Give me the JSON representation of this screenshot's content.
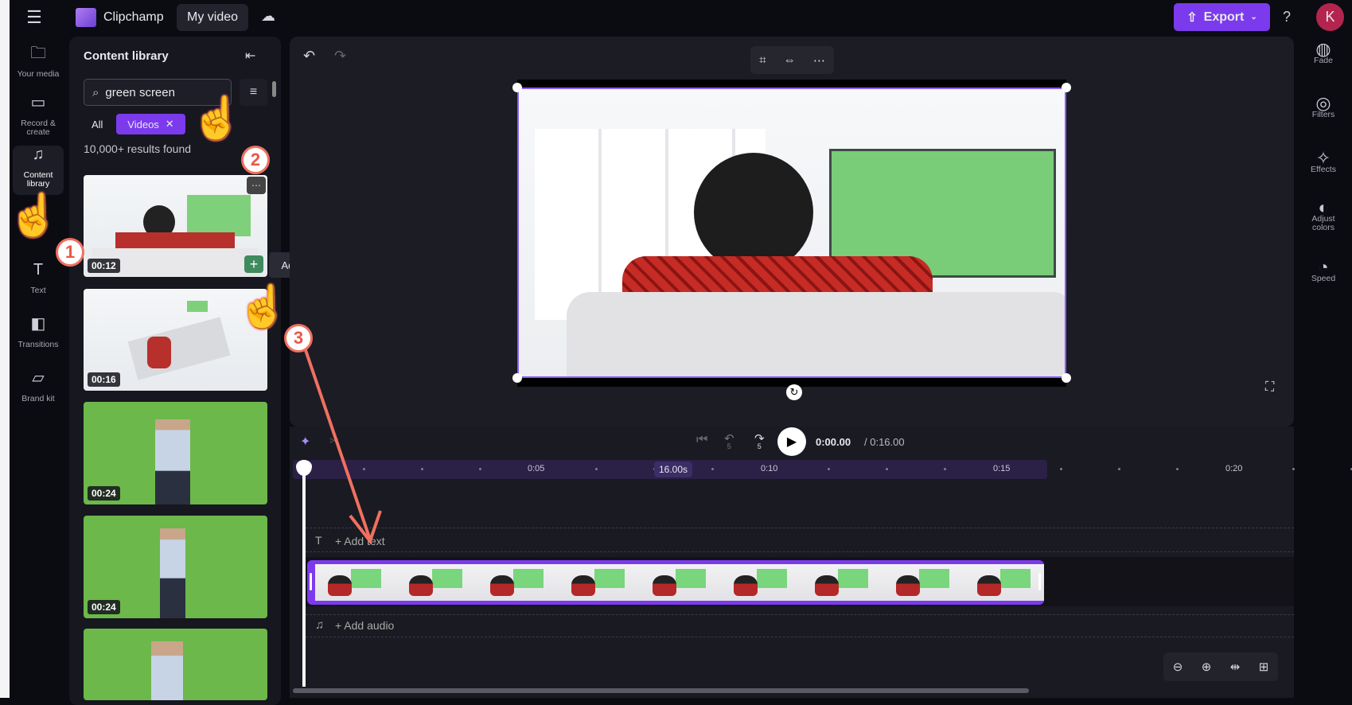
{
  "app": {
    "name": "Clipchamp",
    "project_title": "My video"
  },
  "header": {
    "export_label": "Export",
    "help": "?",
    "avatar_initial": "K",
    "accent": "#7c3aed"
  },
  "left_nav": [
    {
      "label": "Your media",
      "icon": "folder-icon"
    },
    {
      "label": "Record & create",
      "icon": "camera-icon"
    },
    {
      "label": "Content library",
      "icon": "content-library-icon",
      "active": true
    },
    {
      "label": "Text",
      "icon": "text-icon"
    },
    {
      "label": "Transitions",
      "icon": "transitions-icon"
    },
    {
      "label": "Brand kit",
      "icon": "brand-kit-icon"
    }
  ],
  "library": {
    "title": "Content library",
    "search_value": "green screen",
    "filter_all": "All",
    "filter_videos": "Videos",
    "results": "10,000+ results found",
    "items": [
      {
        "duration": "00:12"
      },
      {
        "duration": "00:16"
      },
      {
        "duration": "00:24"
      },
      {
        "duration": "00:24"
      }
    ],
    "tooltip": "Add to timeline"
  },
  "right_panel": [
    {
      "label": "Fade"
    },
    {
      "label": "Filters"
    },
    {
      "label": "Effects"
    },
    {
      "label": "Adjust colors"
    },
    {
      "label": "Speed"
    }
  ],
  "playback": {
    "current": "0:00.00",
    "total": "/ 0:16.00",
    "skip_back": "5",
    "skip_fwd": "5"
  },
  "timeline": {
    "ruler_labels": [
      "0:05",
      "0:10",
      "0:15",
      "0:20"
    ],
    "duration_badge": "16.00s",
    "add_text": "+ Add text",
    "add_audio": "+ Add audio"
  },
  "annotations": [
    "1",
    "2",
    "3"
  ]
}
